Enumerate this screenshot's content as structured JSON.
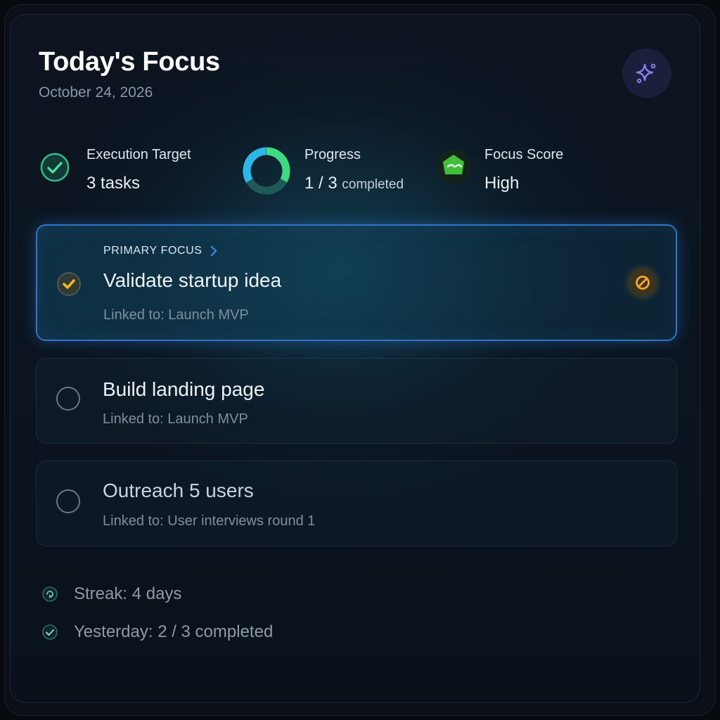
{
  "header": {
    "title": "Today's Focus",
    "date": "October 24, 2026",
    "action_icon": "sparkles-icon"
  },
  "stats": [
    {
      "label": "Execution Target",
      "value": "3 tasks",
      "icon": "check-circle-icon"
    },
    {
      "label": "Progress",
      "value": "1 / 3",
      "value_suffix": "completed",
      "icon": "progress-ring-icon",
      "progress": 0.33
    },
    {
      "label": "Focus Score",
      "value": "High",
      "icon": "focus-gem-icon"
    }
  ],
  "tasks": [
    {
      "kicker": "PRIMARY FOCUS",
      "name": "Validate startup idea",
      "link": "Linked to: Launch MVP",
      "done": true
    },
    {
      "name": "Build landing page",
      "link": "Linked to: Launch MVP",
      "done": false
    },
    {
      "name": "Outreach 5 users",
      "link": "Linked to: User interviews round 1",
      "done": false
    }
  ],
  "footer": {
    "streak": "Streak: 4 days",
    "yesterday": "Yesterday: 2 / 3 completed"
  },
  "colors": {
    "accent_blue": "#2f74c8",
    "progress_green": "#3ddc84",
    "progress_cyan": "#2bb8e6",
    "check_amber": "#f4b51f",
    "sparkle_purple": "#8b7cf6"
  }
}
